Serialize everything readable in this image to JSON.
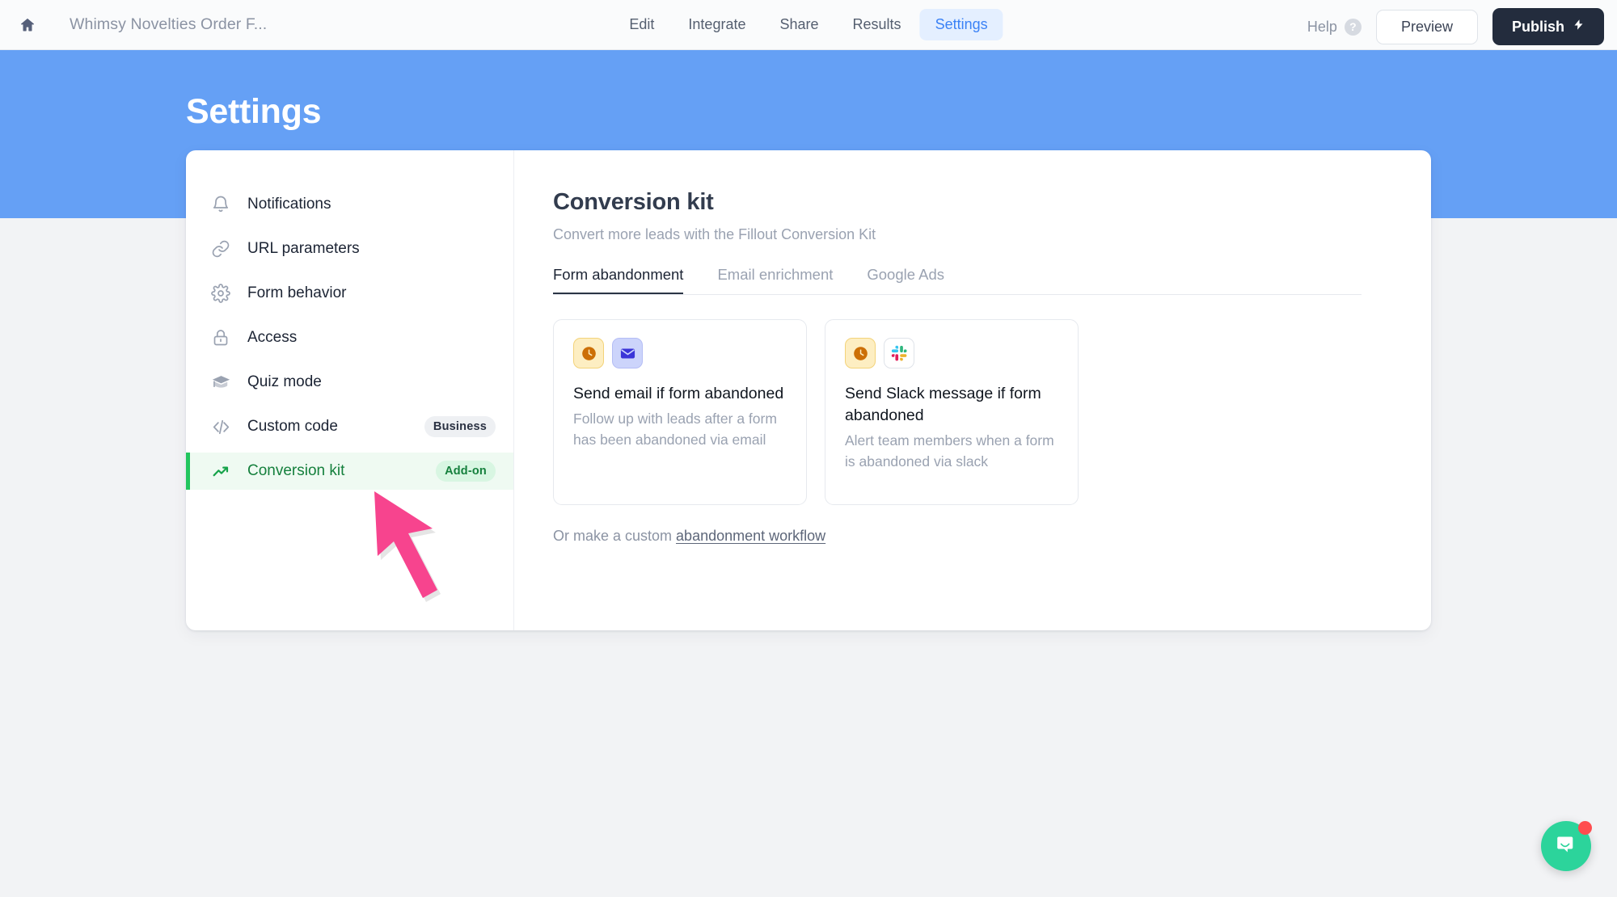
{
  "topbar": {
    "home_icon": "home-icon",
    "form_title": "Whimsy Novelties Order F...",
    "nav": [
      {
        "label": "Edit",
        "active": false
      },
      {
        "label": "Integrate",
        "active": false
      },
      {
        "label": "Share",
        "active": false
      },
      {
        "label": "Results",
        "active": false
      },
      {
        "label": "Settings",
        "active": true
      }
    ],
    "help_label": "Help",
    "help_icon": "question-mark-icon",
    "preview_label": "Preview",
    "publish_label": "Publish",
    "publish_icon": "lightning-bolt-icon"
  },
  "banner": {
    "title": "Settings",
    "color": "#65a0f5"
  },
  "sidebar": {
    "items": [
      {
        "label": "Notifications",
        "icon": "bell-icon",
        "badge": "",
        "active": false
      },
      {
        "label": "URL parameters",
        "icon": "link-icon",
        "badge": "",
        "active": false
      },
      {
        "label": "Form behavior",
        "icon": "gear-icon",
        "badge": "",
        "active": false
      },
      {
        "label": "Access",
        "icon": "lock-icon",
        "badge": "",
        "active": false
      },
      {
        "label": "Quiz mode",
        "icon": "graduation-cap-icon",
        "badge": "",
        "active": false
      },
      {
        "label": "Custom code",
        "icon": "code-brackets-icon",
        "badge": "Business",
        "active": false
      },
      {
        "label": "Conversion kit",
        "icon": "trending-up-icon",
        "badge": "Add-on",
        "active": true
      }
    ],
    "active_color": "#15803d",
    "active_bg": "#effaf2"
  },
  "main": {
    "title": "Conversion kit",
    "subtitle": "Convert more leads with the Fillout Conversion Kit",
    "tabs": [
      {
        "label": "Form abandonment",
        "active": true
      },
      {
        "label": "Email enrichment",
        "active": false
      },
      {
        "label": "Google Ads",
        "active": false
      }
    ],
    "cards": [
      {
        "icons": [
          "clock-icon",
          "envelope-icon"
        ],
        "title": "Send email if form abandoned",
        "description": "Follow up with leads after a form has been abandoned via email"
      },
      {
        "icons": [
          "clock-icon",
          "slack-icon"
        ],
        "title": "Send Slack message if form abandoned",
        "description": "Alert team members when a form is abandoned via slack"
      }
    ],
    "custom_prefix": "Or make a custom ",
    "custom_link": "abandonment workflow"
  },
  "widgets": {
    "intercom_icon": "chat-bubble-icon",
    "intercom_color": "#2cd49b",
    "intercom_badge_color": "#ff4d4f"
  },
  "annotation": {
    "cursor_icon": "arrow-cursor",
    "cursor_color": "#f7448e"
  }
}
